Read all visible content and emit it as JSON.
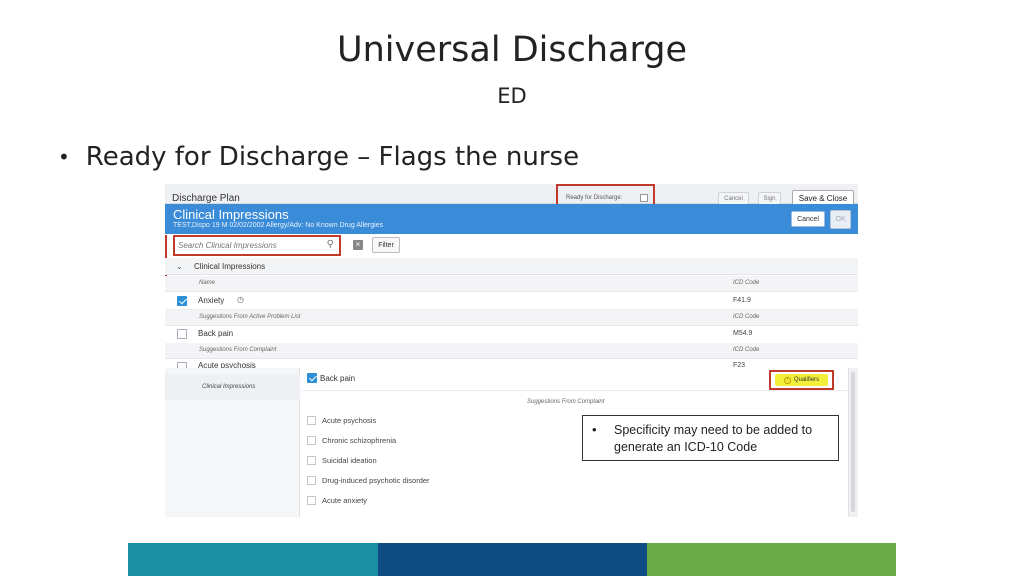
{
  "slide": {
    "title": "Universal Discharge",
    "subtitle": "ED",
    "bullet": "Ready for Discharge – Flags the nurse"
  },
  "discharge_plan": {
    "title": "Discharge Plan",
    "ready_label": "Ready for Discharge:",
    "cancel_label": "Cancel",
    "sign_label": "Sign",
    "save_close_label": "Save & Close"
  },
  "clinical_impressions": {
    "title": "Clinical Impressions",
    "patient_line": "TEST,Dispo  19  M  02/02/2002    Allergy/Adv: No Known Drug Allergies",
    "cancel_label": "Cancel",
    "ok_label": "OK",
    "search_placeholder": "Search Clinical Impressions",
    "filter_label": "Filter",
    "section_label": "Clinical Impressions",
    "col_name": "Name",
    "col_code": "ICD Code",
    "rows": [
      {
        "name": "Anxiety",
        "code": "F41.9",
        "checked": true
      },
      {
        "name": "Back pain",
        "code": "M54.9",
        "checked": false
      },
      {
        "name": "Acute psychosis",
        "code": "F23",
        "checked": false
      }
    ],
    "sub_headers": [
      "Suggestions From Active Problem List",
      "Suggestions From Complaint"
    ]
  },
  "qualifier_panel": {
    "nav_label": "Clinical Impressions",
    "selected_item": "Back pain",
    "qualifiers_label": "Qualifiers",
    "suggestions_label": "Suggestions From Complaint",
    "options": [
      "Acute psychosis",
      "Chronic schizophrenia",
      "Suicidal ideation",
      "Drug-induced psychotic disorder",
      "Acute anxiety"
    ]
  },
  "callout": {
    "text": "Specificity may need to be added to generate an ICD-10 Code"
  },
  "colors": {
    "header_blue": "#3a8bd8",
    "highlight_red": "#c0392b",
    "qualifier_yellow": "#f2ef3a",
    "band_teal": "#1a8fa3",
    "band_navy": "#0f4c81",
    "band_green": "#6aab45"
  }
}
